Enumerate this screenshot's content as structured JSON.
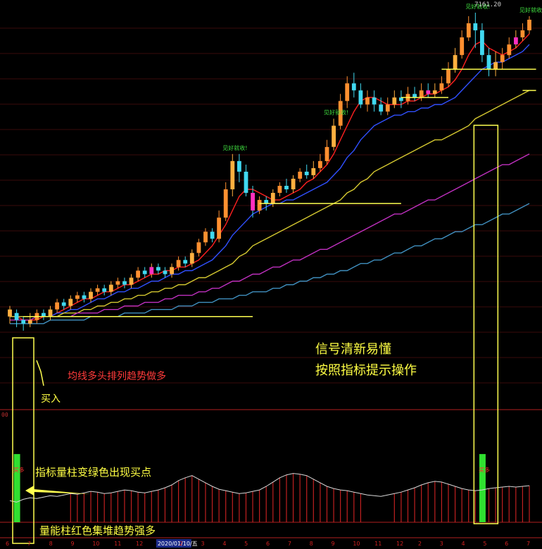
{
  "header": {
    "price_readout": "7161.20",
    "level_readout": "00"
  },
  "chart_data": [
    {
      "type": "candlestick",
      "title": "",
      "ylim": [
        0,
        100
      ],
      "signals": {
        "breakout_label": "见好就收!"
      },
      "candles": [
        [
          14,
          16,
          12,
          17
        ],
        [
          15,
          13,
          11,
          16
        ],
        [
          13,
          12,
          10,
          14
        ],
        [
          12,
          13,
          11,
          15
        ],
        [
          13,
          15,
          12,
          16
        ],
        [
          15,
          14,
          13,
          16
        ],
        [
          14,
          16,
          13,
          17
        ],
        [
          16,
          18,
          15,
          19
        ],
        [
          18,
          17,
          16,
          19
        ],
        [
          17,
          19,
          16,
          20
        ],
        [
          19,
          20,
          18,
          21
        ],
        [
          20,
          19,
          18,
          21
        ],
        [
          19,
          21,
          18,
          22
        ],
        [
          21,
          22,
          20,
          23
        ],
        [
          22,
          21,
          20,
          23
        ],
        [
          21,
          23,
          20,
          24
        ],
        [
          23,
          24,
          22,
          25
        ],
        [
          24,
          23,
          22,
          25
        ],
        [
          23,
          25,
          22,
          26
        ],
        [
          25,
          27,
          24,
          28
        ],
        [
          27,
          26,
          25,
          28
        ],
        [
          26,
          28,
          25,
          29
        ],
        [
          28,
          27,
          26,
          29
        ],
        [
          27,
          26,
          25,
          28
        ],
        [
          26,
          28,
          25,
          29
        ],
        [
          28,
          30,
          27,
          31
        ],
        [
          30,
          29,
          28,
          31
        ],
        [
          29,
          32,
          28,
          33
        ],
        [
          32,
          35,
          31,
          36
        ],
        [
          35,
          38,
          34,
          39
        ],
        [
          38,
          36,
          35,
          39
        ],
        [
          36,
          42,
          35,
          44
        ],
        [
          42,
          50,
          41,
          52
        ],
        [
          50,
          58,
          48,
          60
        ],
        [
          58,
          55,
          52,
          60
        ],
        [
          55,
          49,
          48,
          57
        ],
        [
          49,
          44,
          42,
          51
        ],
        [
          44,
          47,
          43,
          48
        ],
        [
          47,
          46,
          44,
          48
        ],
        [
          46,
          49,
          45,
          50
        ],
        [
          49,
          51,
          48,
          52
        ],
        [
          51,
          50,
          49,
          53
        ],
        [
          50,
          53,
          49,
          54
        ],
        [
          53,
          55,
          52,
          56
        ],
        [
          55,
          54,
          53,
          57
        ],
        [
          54,
          56,
          53,
          58
        ],
        [
          56,
          58,
          55,
          60
        ],
        [
          58,
          62,
          57,
          64
        ],
        [
          62,
          68,
          61,
          70
        ],
        [
          68,
          75,
          67,
          77
        ],
        [
          75,
          80,
          73,
          82
        ],
        [
          80,
          78,
          76,
          83
        ],
        [
          78,
          74,
          73,
          80
        ],
        [
          74,
          76,
          72,
          78
        ],
        [
          76,
          74,
          72,
          78
        ],
        [
          74,
          72,
          71,
          76
        ],
        [
          72,
          74,
          71,
          76
        ],
        [
          74,
          76,
          73,
          78
        ],
        [
          76,
          75,
          73,
          78
        ],
        [
          75,
          77,
          74,
          79
        ],
        [
          77,
          76,
          75,
          79
        ],
        [
          76,
          78,
          75,
          80
        ],
        [
          78,
          77,
          76,
          80
        ],
        [
          77,
          78,
          76,
          80
        ],
        [
          78,
          80,
          77,
          82
        ],
        [
          80,
          84,
          79,
          86
        ],
        [
          84,
          88,
          83,
          90
        ],
        [
          88,
          93,
          87,
          95
        ],
        [
          93,
          97,
          92,
          99
        ],
        [
          97,
          95,
          90,
          100
        ],
        [
          95,
          88,
          86,
          97
        ],
        [
          88,
          84,
          82,
          90
        ],
        [
          84,
          86,
          82,
          89
        ],
        [
          86,
          88,
          84,
          90
        ],
        [
          88,
          91,
          87,
          93
        ],
        [
          91,
          93,
          90,
          95
        ],
        [
          93,
          95,
          92,
          97
        ],
        [
          95,
          98,
          94,
          99
        ]
      ],
      "series": [
        {
          "values": [
            14,
            14,
            13,
            13,
            13,
            14,
            14,
            15,
            16,
            17,
            18,
            19,
            19,
            20,
            21,
            21,
            22,
            23,
            23,
            24,
            25,
            26,
            26,
            27,
            27,
            28,
            28,
            29,
            30,
            32,
            34,
            37,
            40,
            44,
            48,
            50,
            50,
            49,
            48,
            47,
            47,
            48,
            49,
            50,
            52,
            53,
            55,
            57,
            60,
            64,
            68,
            72,
            75,
            76,
            76,
            75,
            74,
            74,
            74,
            75,
            75,
            76,
            77,
            77,
            78,
            79,
            81,
            84,
            88,
            91,
            92,
            90,
            89,
            88,
            89,
            90,
            92,
            94
          ]
        },
        {
          "values": [
            14,
            14,
            14,
            14,
            14,
            14,
            14,
            15,
            15,
            16,
            16,
            17,
            18,
            19,
            19,
            20,
            21,
            21,
            22,
            22,
            23,
            24,
            24,
            25,
            26,
            26,
            27,
            27,
            28,
            29,
            30,
            32,
            34,
            37,
            39,
            41,
            43,
            44,
            45,
            46,
            46,
            47,
            47,
            48,
            49,
            50,
            51,
            52,
            54,
            56,
            59,
            61,
            64,
            66,
            68,
            69,
            70,
            71,
            71,
            72,
            72,
            73,
            73,
            74,
            74,
            75,
            76,
            78,
            80,
            82,
            84,
            85,
            86,
            86,
            87,
            88,
            89,
            91
          ]
        },
        {
          "values": [
            14,
            14,
            14,
            14,
            14,
            14,
            14,
            14,
            15,
            15,
            15,
            16,
            16,
            17,
            17,
            18,
            18,
            19,
            19,
            20,
            20,
            21,
            21,
            22,
            22,
            23,
            23,
            24,
            25,
            25,
            26,
            27,
            28,
            29,
            31,
            32,
            34,
            35,
            36,
            37,
            38,
            39,
            40,
            41,
            42,
            43,
            44,
            45,
            46,
            47,
            49,
            50,
            52,
            53,
            55,
            56,
            57,
            58,
            59,
            60,
            61,
            62,
            63,
            64,
            64,
            65,
            66,
            67,
            68,
            70,
            71,
            72,
            73,
            74,
            75,
            76,
            77,
            78
          ]
        },
        {
          "values": [
            13,
            13,
            13,
            13,
            14,
            14,
            14,
            14,
            14,
            14,
            15,
            15,
            15,
            15,
            16,
            16,
            16,
            17,
            17,
            17,
            18,
            18,
            18,
            19,
            19,
            20,
            20,
            20,
            21,
            21,
            22,
            22,
            23,
            24,
            24,
            25,
            26,
            26,
            27,
            28,
            28,
            29,
            30,
            30,
            31,
            32,
            33,
            33,
            34,
            35,
            36,
            37,
            38,
            39,
            40,
            41,
            42,
            43,
            43,
            44,
            45,
            46,
            47,
            47,
            48,
            49,
            50,
            51,
            52,
            53,
            54,
            55,
            56,
            57,
            57,
            58,
            59,
            60
          ]
        },
        {
          "values": [
            12,
            12,
            12,
            12,
            12,
            12,
            13,
            13,
            13,
            13,
            13,
            13,
            14,
            14,
            14,
            14,
            14,
            15,
            15,
            15,
            15,
            16,
            16,
            16,
            16,
            17,
            17,
            17,
            18,
            18,
            18,
            19,
            19,
            19,
            20,
            20,
            21,
            21,
            21,
            22,
            22,
            23,
            23,
            24,
            24,
            25,
            25,
            26,
            26,
            27,
            27,
            28,
            29,
            29,
            30,
            30,
            31,
            32,
            32,
            33,
            34,
            34,
            35,
            36,
            36,
            37,
            38,
            38,
            39,
            40,
            40,
            41,
            42,
            43,
            43,
            44,
            45,
            46
          ]
        }
      ]
    },
    {
      "type": "bar",
      "title": "",
      "ylim": [
        0,
        100
      ],
      "values": [
        30,
        28,
        32,
        34,
        33,
        35,
        37,
        36,
        38,
        40,
        39,
        41,
        43,
        42,
        40,
        41,
        43,
        45,
        44,
        42,
        41,
        43,
        45,
        48,
        52,
        58,
        62,
        65,
        60,
        55,
        50,
        46,
        44,
        42,
        40,
        41,
        43,
        45,
        50,
        56,
        62,
        66,
        68,
        67,
        65,
        60,
        55,
        50,
        47,
        45,
        44,
        42,
        40,
        38,
        37,
        36,
        38,
        40,
        42,
        45,
        48,
        52,
        55,
        57,
        56,
        53,
        50,
        47,
        45,
        44,
        45,
        47,
        48,
        49,
        50,
        49,
        50,
        51
      ]
    }
  ],
  "annotations": {
    "ma_trend": "均线多头排列趋势做多",
    "buy_label": "买入",
    "signal_line1": "信号清新易懂",
    "signal_line2": "按照指标提示操作",
    "green_buy_point": "指标量柱变绿色出现买点",
    "red_bars_trend": "量能柱红色集堆趋势强多",
    "bar_tag": "买多"
  },
  "date_axis": {
    "ticks": [
      "6",
      "7",
      "8",
      "9",
      "10",
      "11",
      "12",
      "2020/01/10/五",
      "2",
      "3",
      "4",
      "5",
      "6",
      "7",
      "8",
      "9",
      "10",
      "11",
      "12",
      "2",
      "3",
      "4",
      "5",
      "6",
      "7"
    ]
  }
}
